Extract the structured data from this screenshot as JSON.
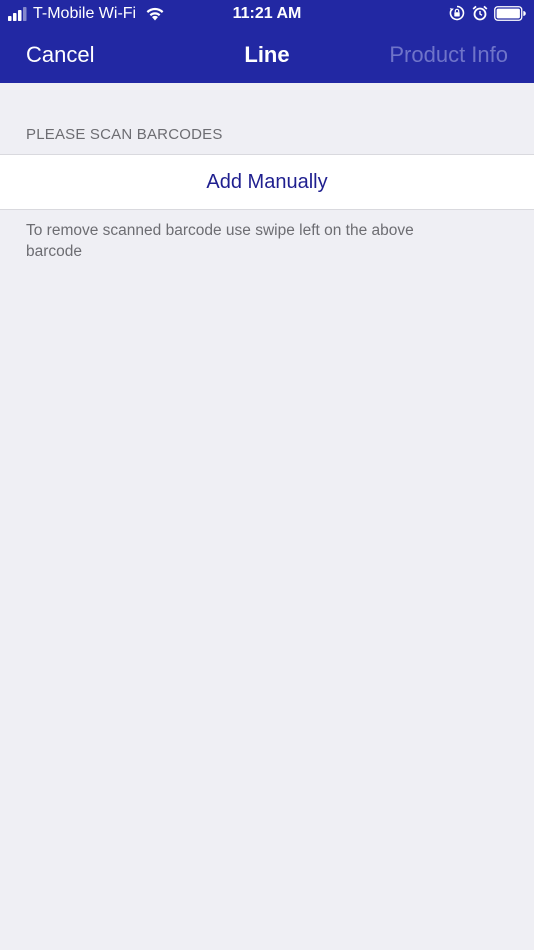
{
  "status_bar": {
    "carrier": "T-Mobile Wi-Fi",
    "time": "11:21 AM",
    "icons": [
      "signal-icon",
      "wifi-icon",
      "orientation-lock-icon",
      "alarm-icon",
      "battery-icon"
    ]
  },
  "nav": {
    "cancel_label": "Cancel",
    "title": "Line",
    "product_info_label": "Product Info"
  },
  "scan": {
    "section_header": "PLEASE SCAN BARCODES",
    "add_manually_label": "Add Manually",
    "footer_note": "To remove scanned barcode use swipe left on the above barcode"
  },
  "colors": {
    "nav_background": "#2228a3",
    "nav_disabled_text": "#6f74c9",
    "page_background": "#efeff4",
    "action_text": "#1f1f8f",
    "secondary_text": "#6d6d72"
  }
}
